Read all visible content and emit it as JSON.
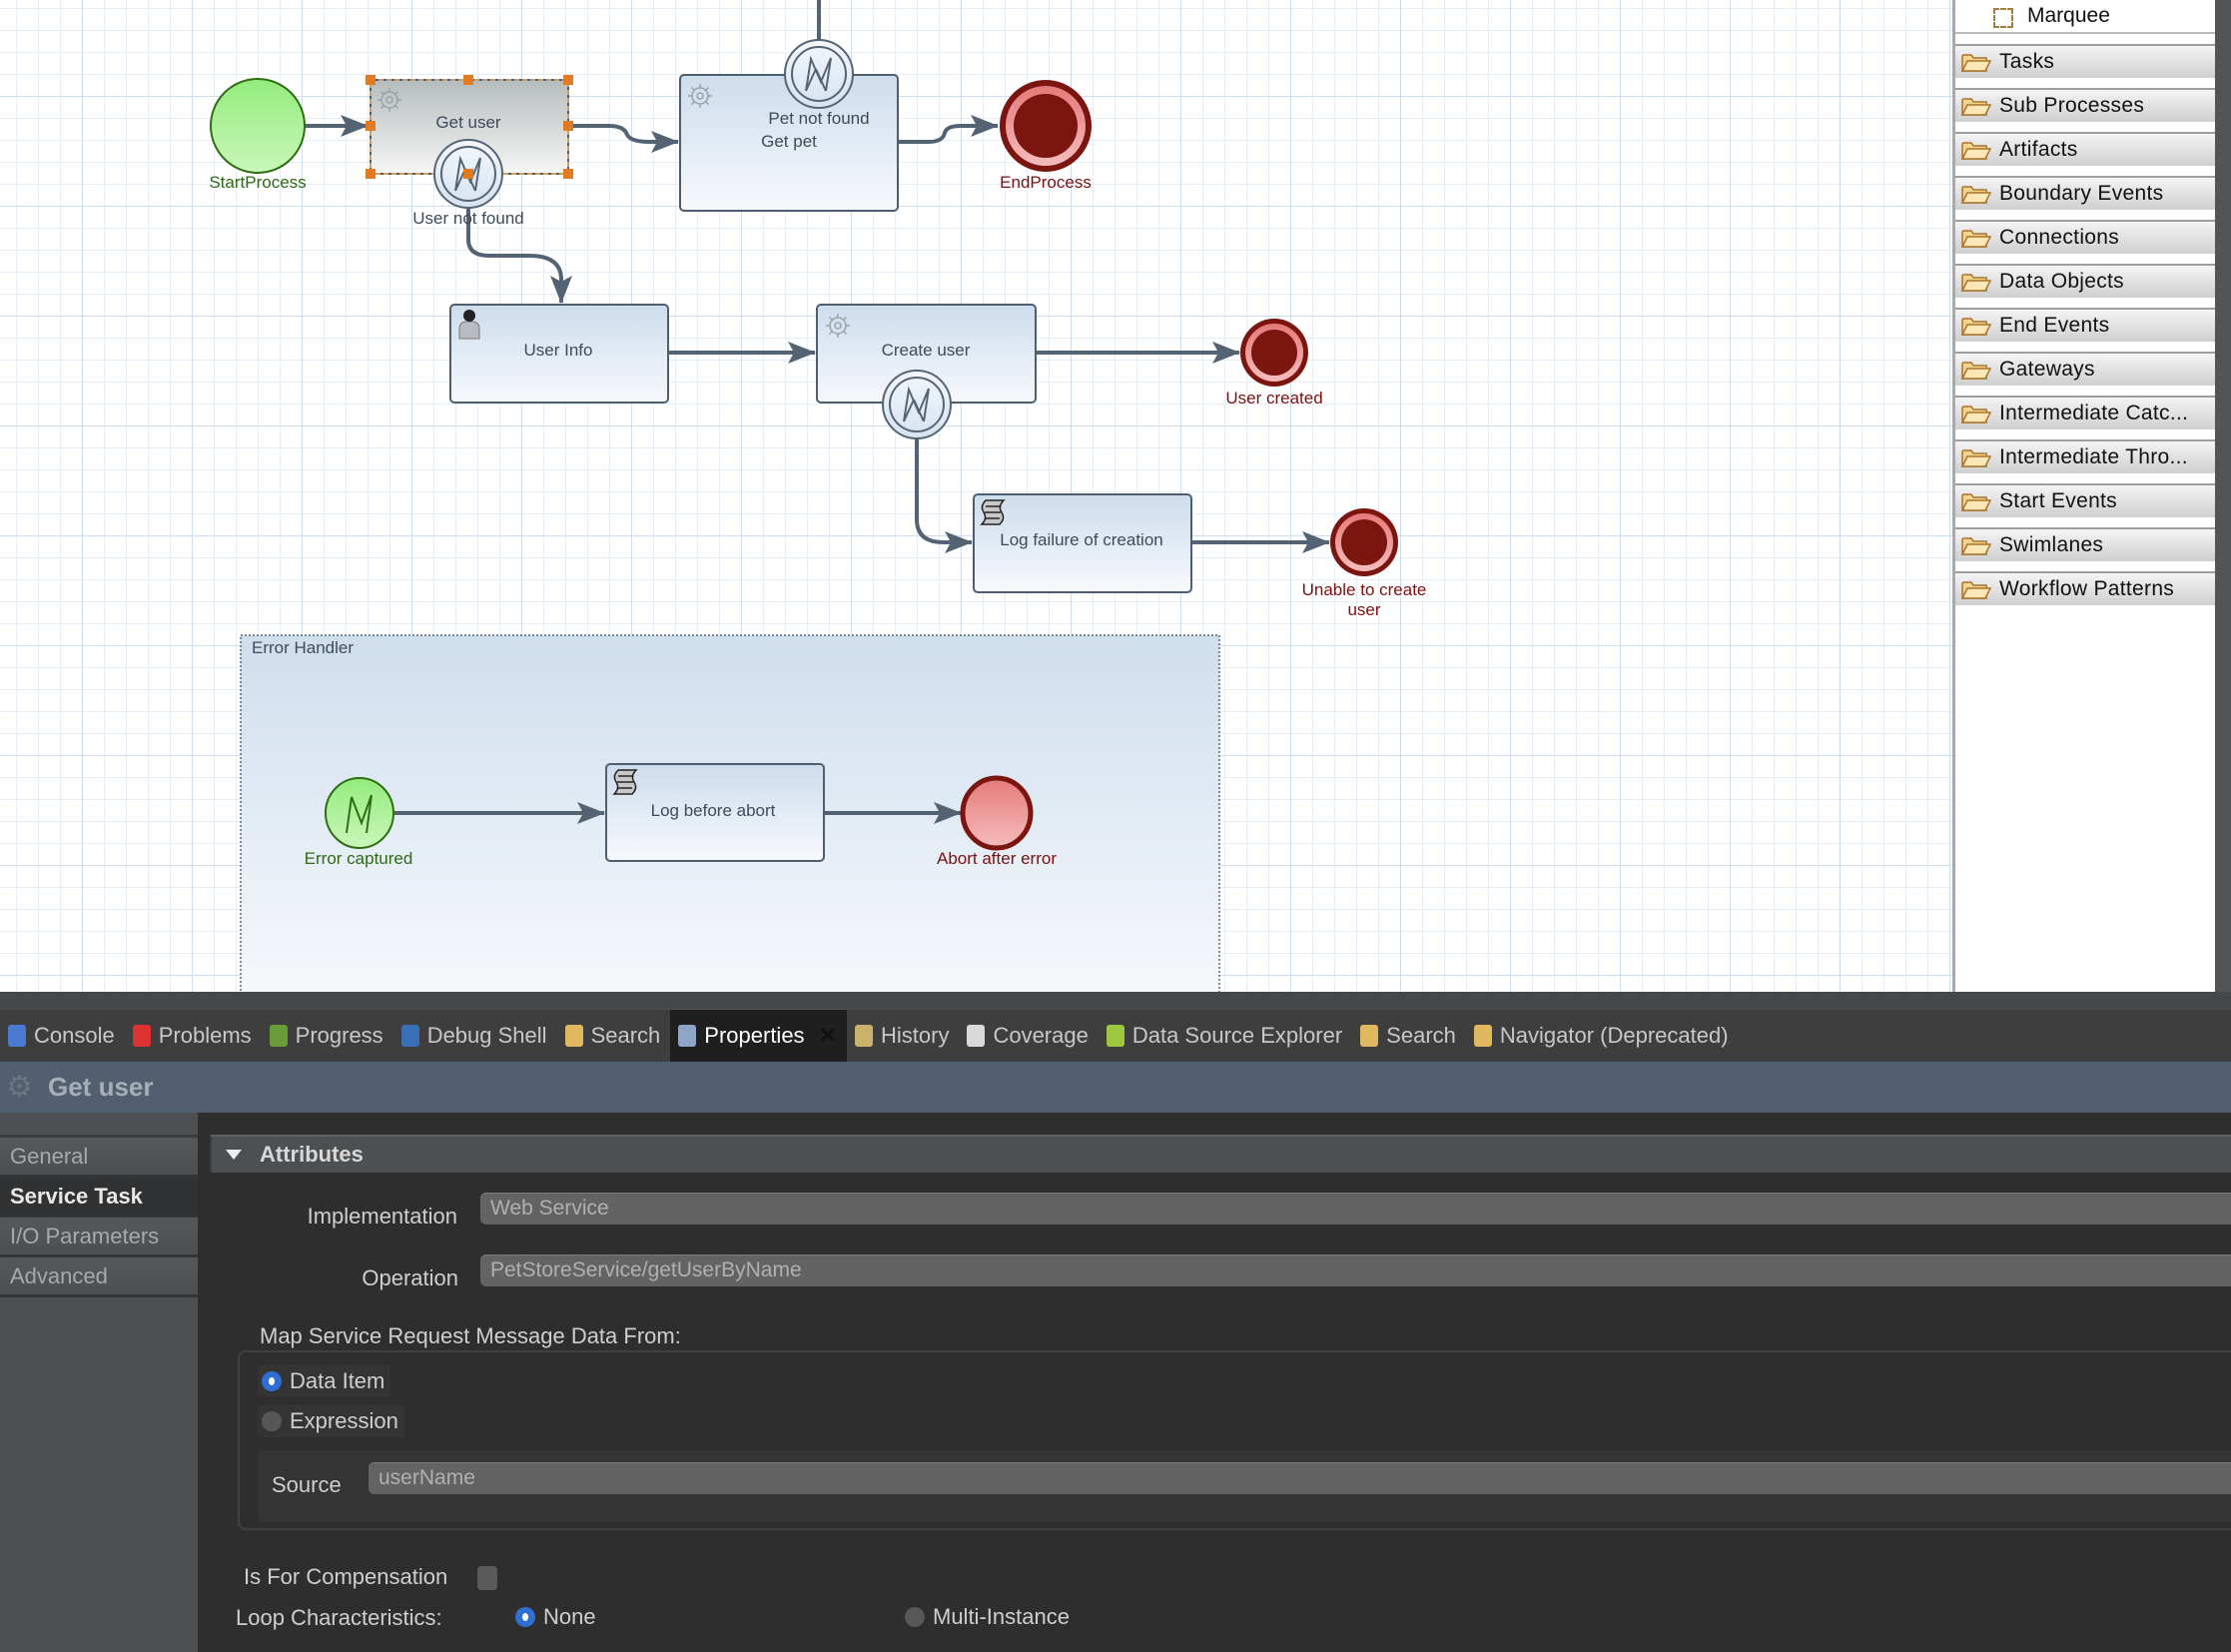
{
  "diagram": {
    "nodes": {
      "start_process": {
        "label": "StartProcess",
        "type": "start-event"
      },
      "get_user": {
        "label": "Get user",
        "type": "service-task",
        "selected": true
      },
      "user_not_found": {
        "label": "User not found",
        "type": "error-boundary-event"
      },
      "get_pet": {
        "label": "Get pet",
        "type": "service-task"
      },
      "pet_not_found": {
        "label": "Pet not found",
        "type": "error-boundary-event"
      },
      "end_process": {
        "label": "EndProcess",
        "type": "end-event"
      },
      "user_info": {
        "label": "User Info",
        "type": "user-task"
      },
      "create_user": {
        "label": "Create user",
        "type": "service-task"
      },
      "user_created": {
        "label": "User created",
        "type": "end-event"
      },
      "log_failure": {
        "label": "Log failure of creation",
        "type": "script-task"
      },
      "unable_to_create_line1": {
        "label": "Unable to create",
        "type": "end-event"
      },
      "unable_to_create_line2": {
        "label": "user"
      },
      "error_handler": {
        "label": "Error Handler",
        "type": "event-subprocess"
      },
      "error_captured": {
        "label": "Error captured",
        "type": "error-start-event"
      },
      "log_before_abort": {
        "label": "Log before abort",
        "type": "script-task"
      },
      "abort_after_error": {
        "label": "Abort after error",
        "type": "end-event"
      }
    }
  },
  "palette": {
    "marquee": "Marquee",
    "drawers": [
      "Tasks",
      "Sub Processes",
      "Artifacts",
      "Boundary Events",
      "Connections",
      "Data Objects",
      "End Events",
      "Gateways",
      "Intermediate Catc...",
      "Intermediate Thro...",
      "Start Events",
      "Swimlanes",
      "Workflow Patterns"
    ]
  },
  "view_tabs": [
    {
      "label": "Console",
      "icon": "console-icon"
    },
    {
      "label": "Problems",
      "icon": "problems-icon"
    },
    {
      "label": "Progress",
      "icon": "progress-icon"
    },
    {
      "label": "Debug Shell",
      "icon": "debug-shell-icon"
    },
    {
      "label": "Search",
      "icon": "search-icon"
    },
    {
      "label": "Properties",
      "icon": "properties-icon",
      "active": true
    },
    {
      "label": "History",
      "icon": "history-icon"
    },
    {
      "label": "Coverage",
      "icon": "coverage-icon"
    },
    {
      "label": "Data Source Explorer",
      "icon": "data-source-explorer-icon"
    },
    {
      "label": "Search",
      "icon": "search-icon"
    },
    {
      "label": "Navigator (Deprecated)",
      "icon": "navigator-icon"
    }
  ],
  "properties": {
    "title": "Get user",
    "nav": [
      "General",
      "Service Task",
      "I/O Parameters",
      "Advanced"
    ],
    "active_nav": "Service Task",
    "section_title": "Attributes",
    "implementation_label": "Implementation",
    "implementation_value": "Web Service",
    "operation_label": "Operation",
    "operation_value": "PetStoreService/getUserByName",
    "map_label": "Map Service Request Message Data From:",
    "map_options": {
      "data_item": "Data Item",
      "expression": "Expression"
    },
    "map_selected": "Data Item",
    "source_label": "Source",
    "source_value": "userName",
    "compensation_label": "Is For Compensation",
    "compensation_checked": false,
    "loop_label": "Loop Characteristics:",
    "loop_options": {
      "none": "None",
      "multi": "Multi-Instance"
    },
    "loop_selected": "None"
  }
}
